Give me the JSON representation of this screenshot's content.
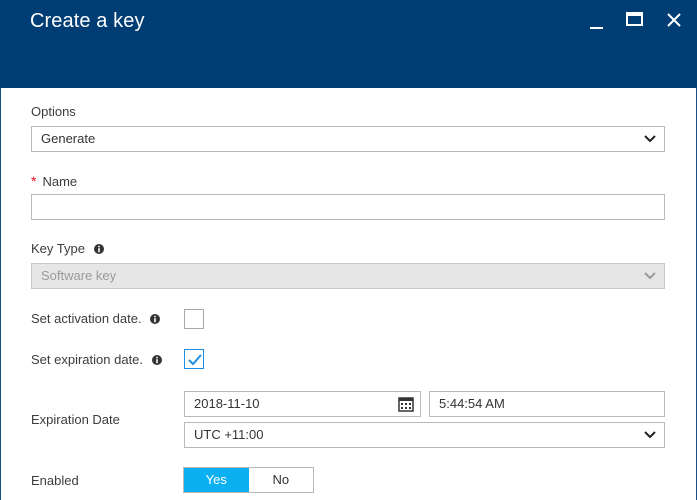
{
  "header": {
    "title": "Create a key"
  },
  "options": {
    "label": "Options",
    "value": "Generate"
  },
  "name": {
    "required_mark": "*",
    "label": "Name",
    "value": ""
  },
  "key_type": {
    "label": "Key Type",
    "value": "Software key",
    "disabled": true
  },
  "activation": {
    "label": "Set activation date.",
    "checked": false
  },
  "expiration": {
    "label": "Set expiration date.",
    "checked": true
  },
  "expiration_date": {
    "label": "Expiration Date",
    "date": "2018-11-10",
    "time": "5:44:54 AM",
    "timezone": "UTC +11:00"
  },
  "enabled": {
    "label": "Enabled",
    "yes_label": "Yes",
    "no_label": "No",
    "selected": "Yes"
  },
  "colors": {
    "header_bg": "#003d75",
    "accent": "#0ab0f0",
    "required": "#e00b1c"
  },
  "icons": [
    "minimize-icon",
    "maximize-icon",
    "close-icon",
    "chevron-down-icon",
    "info-icon",
    "checkmark-icon",
    "calendar-icon"
  ]
}
